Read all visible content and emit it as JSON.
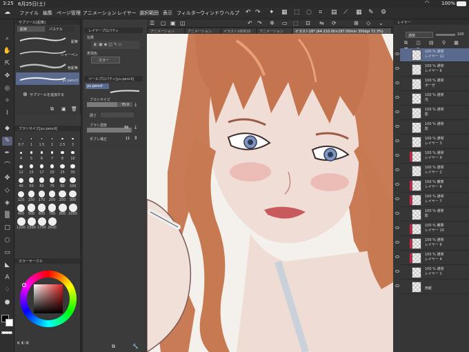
{
  "status_bar": {
    "time": "3:25",
    "date": "6月25日(土)",
    "battery": "100%"
  },
  "menu": {
    "items": [
      "ファイル",
      "編集",
      "ページ管理",
      "アニメーション",
      "レイヤー",
      "選択範囲",
      "表示",
      "フィルター",
      "ウィンドウ",
      "ヘルプ"
    ]
  },
  "tabs": [
    {
      "label": "アニメーション"
    },
    {
      "label": "アニメーション"
    },
    {
      "label": "イラスト160819"
    },
    {
      "label": "アニメーション"
    },
    {
      "label": "イラスト16* (A4 210.00×297.00mm 350dpi 72.3%)"
    }
  ],
  "subtool_panel": {
    "title": "サブツール[鉛筆]",
    "tabs": [
      "鉛筆",
      "パステル"
    ],
    "brushes": [
      {
        "label": "鉛筆"
      },
      {
        "label": "シャーペン"
      },
      {
        "label": "色鉛筆"
      },
      {
        "label": "yu pencil"
      }
    ],
    "add_label": "サブツールを追加する"
  },
  "brush_size_panel": {
    "title": "ブラシサイズ[yu pencil]",
    "sizes": [
      "0.7",
      "1",
      "1.5",
      "2",
      "2.5",
      "3",
      "4",
      "5",
      "6",
      "7",
      "8",
      "10",
      "12",
      "15",
      "17",
      "20",
      "25",
      "30",
      "40",
      "50",
      "60",
      "70",
      "80",
      "100",
      "120",
      "150",
      "170",
      "200",
      "250",
      "300",
      "400",
      "500",
      "600",
      "700",
      "800",
      "1000",
      "1200",
      "1500",
      "1700",
      "2000"
    ]
  },
  "color_panel": {
    "title": "カラーサークル",
    "accent": "#9a2a2a"
  },
  "layer_property": {
    "title": "レイヤープロパティ",
    "effect_label": "効果",
    "color_label": "表現色",
    "color_value": "カラー"
  },
  "tool_property": {
    "title": "ツールプロパティ[yu pencil]",
    "brush_name": "yu pencil",
    "brush_size_label": "ブラシサイズ",
    "brush_size_value": "70.0",
    "hardness_label": "硬さ",
    "density_label": "ブラシ濃度",
    "density_value": "99",
    "stabilization_label": "手ブレ補正",
    "stabilization_value": "11"
  },
  "layer_panel": {
    "title": "レイヤー",
    "blend_mode": "通常",
    "opacity": "100",
    "layers": [
      {
        "opacity": "100 %",
        "mode": "通常",
        "name": "レイヤー 11",
        "selected": true,
        "mask": false
      },
      {
        "opacity": "100 %",
        "mode": "通常",
        "name": "レイヤー 6",
        "selected": false,
        "mask": false
      },
      {
        "opacity": "100 %",
        "mode": "通常",
        "name": "ボーゼ",
        "selected": false,
        "mask": false
      },
      {
        "opacity": "100 %",
        "mode": "通常",
        "name": "光",
        "selected": false,
        "mask": false
      },
      {
        "opacity": "100 %",
        "mode": "通常",
        "name": "影",
        "selected": false,
        "mask": false
      },
      {
        "opacity": "100 %",
        "mode": "通常",
        "name": "影",
        "selected": false,
        "mask": false
      },
      {
        "opacity": "100 %",
        "mode": "通常",
        "name": "レイヤー 3",
        "selected": false,
        "mask": false
      },
      {
        "opacity": "100 %",
        "mode": "通常",
        "name": "レイヤー 9",
        "selected": false,
        "mask": true
      },
      {
        "opacity": "100 %",
        "mode": "通常",
        "name": "レイヤー 2",
        "selected": false,
        "mask": false
      },
      {
        "opacity": "100 %",
        "mode": "乗算",
        "name": "レイヤー 8",
        "selected": false,
        "mask": true
      },
      {
        "opacity": "100 %",
        "mode": "通常",
        "name": "レイヤー 7",
        "selected": false,
        "mask": true
      },
      {
        "opacity": "100 %",
        "mode": "通常",
        "name": "影",
        "selected": false,
        "mask": false
      },
      {
        "opacity": "100 %",
        "mode": "乗算",
        "name": "レイヤー 10",
        "selected": false,
        "mask": true
      },
      {
        "opacity": "100 %",
        "mode": "通常",
        "name": "レイヤー 6",
        "selected": false,
        "mask": true
      },
      {
        "opacity": "100 %",
        "mode": "通常",
        "name": "レイヤー 4",
        "selected": false,
        "mask": true
      },
      {
        "opacity": "100 %",
        "mode": "通常",
        "name": "レイヤー 1",
        "selected": false,
        "mask": false
      },
      {
        "opacity": "",
        "mode": "",
        "name": "用紙",
        "selected": false,
        "mask": false
      }
    ]
  }
}
